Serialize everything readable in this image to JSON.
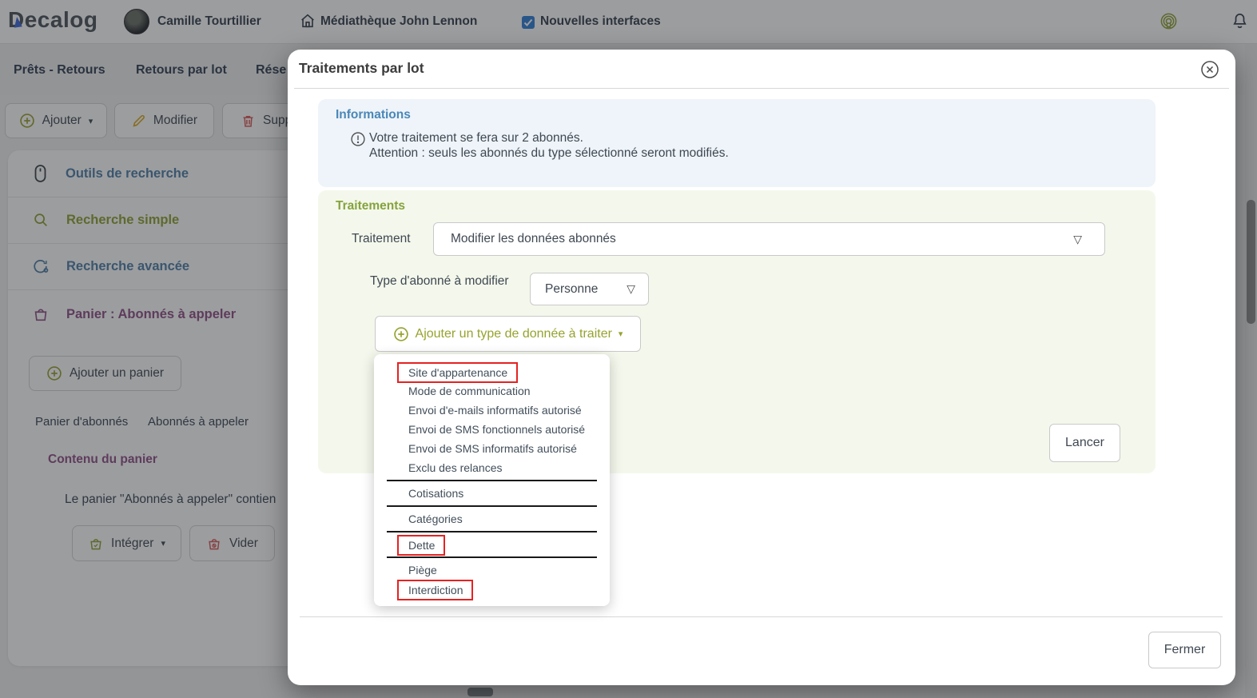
{
  "header": {
    "logo": "Decalog",
    "user_name": "Camille Tourtillier",
    "library_name": "Médiathèque John Lennon",
    "checkbox_label": "Nouvelles interfaces",
    "checkbox_checked": true
  },
  "nav": {
    "tabs": [
      {
        "label": "Prêts - Retours"
      },
      {
        "label": "Retours par lot"
      },
      {
        "label": "Rése"
      }
    ]
  },
  "toolbar": {
    "add_label": "Ajouter",
    "edit_label": "Modifier",
    "delete_label": "Supp"
  },
  "sidebar": {
    "items": [
      {
        "label": "Outils de recherche",
        "color": "#4e7ea6"
      },
      {
        "label": "Recherche simple",
        "color": "#8fa032"
      },
      {
        "label": "Recherche avancée",
        "color": "#4e7ea6"
      },
      {
        "label": "Panier : Abonnés à appeler",
        "color": "#8e4f86"
      }
    ],
    "add_basket_label": "Ajouter un panier",
    "tabs": [
      {
        "label": "Panier d'abonnés"
      },
      {
        "label": "Abonnés à appeler"
      }
    ],
    "content_title": "Contenu du panier",
    "content_text": "Le panier \"Abonnés à appeler\" contien",
    "integrate_label": "Intégrer",
    "empty_label": "Vider"
  },
  "modal": {
    "title": "Traitements par lot",
    "info": {
      "heading": "Informations",
      "line1": "Votre traitement se fera sur 2 abonnés.",
      "line2": "Attention : seuls les abonnés du type sélectionné seront modifiés."
    },
    "treatments": {
      "heading": "Traitements",
      "treatment_label": "Traitement",
      "treatment_value": "Modifier les données abonnés",
      "type_label": "Type d'abonné à modifier",
      "type_value": "Personne",
      "add_data_type_label": "Ajouter un type de donnée à traiter",
      "launch_label": "Lancer"
    },
    "menu": {
      "groups": [
        {
          "items": [
            {
              "label": "Site d'appartenance",
              "highlighted": true
            },
            {
              "label": "Mode de communication",
              "highlighted": false
            },
            {
              "label": "Envoi d'e-mails informatifs autorisé",
              "highlighted": false
            },
            {
              "label": "Envoi de SMS fonctionnels autorisé",
              "highlighted": false
            },
            {
              "label": "Envoi de SMS informatifs autorisé",
              "highlighted": false
            },
            {
              "label": "Exclu des relances",
              "highlighted": false
            }
          ]
        },
        {
          "items": [
            {
              "label": "Cotisations",
              "highlighted": false
            }
          ]
        },
        {
          "items": [
            {
              "label": "Catégories",
              "highlighted": false
            }
          ]
        },
        {
          "items": [
            {
              "label": "Dette",
              "highlighted": true
            }
          ]
        },
        {
          "items": [
            {
              "label": "Piège",
              "highlighted": false
            },
            {
              "label": "Interdiction",
              "highlighted": true
            }
          ]
        }
      ]
    },
    "close_label": "Fermer"
  },
  "colors": {
    "accent_olive": "#97a22d",
    "accent_blue": "#4a87b8",
    "accent_purple": "#8e4f86",
    "accent_red": "#d95858",
    "accent_yellow": "#d9a91d",
    "highlight_red": "#e52222",
    "checkbox_blue": "#2f7fd6",
    "info_bg": "#eef4f9",
    "treatments_bg": "#f4f8ec"
  }
}
